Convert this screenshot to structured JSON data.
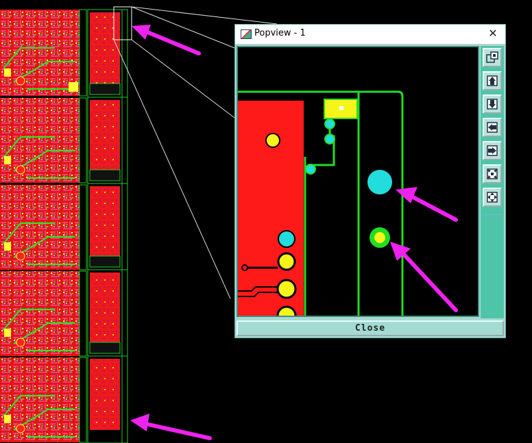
{
  "popup": {
    "title": "Popview - 1",
    "close_x": "✕",
    "close_label": "Close"
  },
  "toolbar": {
    "icons": [
      "zoom-in-icon",
      "pan-up-icon",
      "pan-down-icon",
      "pan-left-icon",
      "pan-right-icon",
      "zoom-out-icon",
      "fit-view-icon"
    ]
  },
  "colors": {
    "background": "#000000",
    "copper": "#ff1a1a",
    "trace": "#22dd22",
    "via_cyan": "#22dddd",
    "pad_yellow": "#f5f51a",
    "arrow": "#ee22ee",
    "panel": "#a9d9d0"
  }
}
